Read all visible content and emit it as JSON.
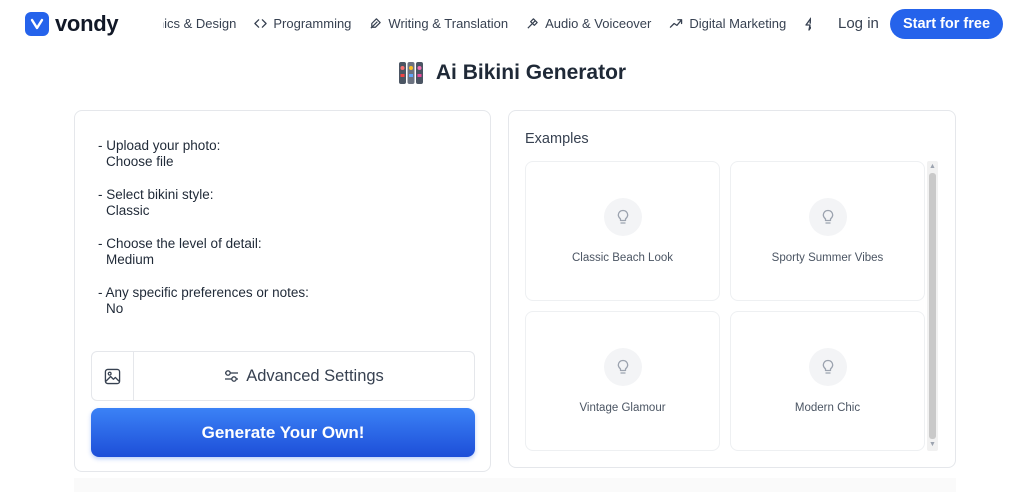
{
  "header": {
    "logo_text": "vondy",
    "nav": [
      {
        "label": "Graphics & Design",
        "icon": "pen-tool-icon"
      },
      {
        "label": "Programming",
        "icon": "code-brackets-icon"
      },
      {
        "label": "Writing & Translation",
        "icon": "feather-pen-icon"
      },
      {
        "label": "Audio & Voiceover",
        "icon": "microphone-icon"
      },
      {
        "label": "Digital Marketing",
        "icon": "trending-up-icon"
      },
      {
        "label": "",
        "icon": "lightning-icon"
      }
    ],
    "login_label": "Log in",
    "cta_label": "Start for free",
    "accent_color": "#2563eb"
  },
  "page": {
    "title": "Ai Bikini Generator",
    "title_icon": "bikini-emoji-icon"
  },
  "form": {
    "fields": [
      {
        "label": "- Upload your photo:",
        "value": "Choose file"
      },
      {
        "label": "- Select bikini style:",
        "value": "Classic"
      },
      {
        "label": "- Choose the level of detail:",
        "value": "Medium"
      },
      {
        "label": "- Any specific preferences or notes:",
        "value": "No"
      }
    ],
    "image_button_icon": "image-icon",
    "advanced_label": "Advanced Settings",
    "advanced_icon": "sliders-icon",
    "generate_label": "Generate Your Own!"
  },
  "examples": {
    "title": "Examples",
    "items": [
      {
        "label": "Classic Beach Look",
        "icon": "lightbulb-icon"
      },
      {
        "label": "Sporty Summer Vibes",
        "icon": "lightbulb-icon"
      },
      {
        "label": "Vintage Glamour",
        "icon": "lightbulb-icon"
      },
      {
        "label": "Modern Chic",
        "icon": "lightbulb-icon"
      }
    ]
  }
}
